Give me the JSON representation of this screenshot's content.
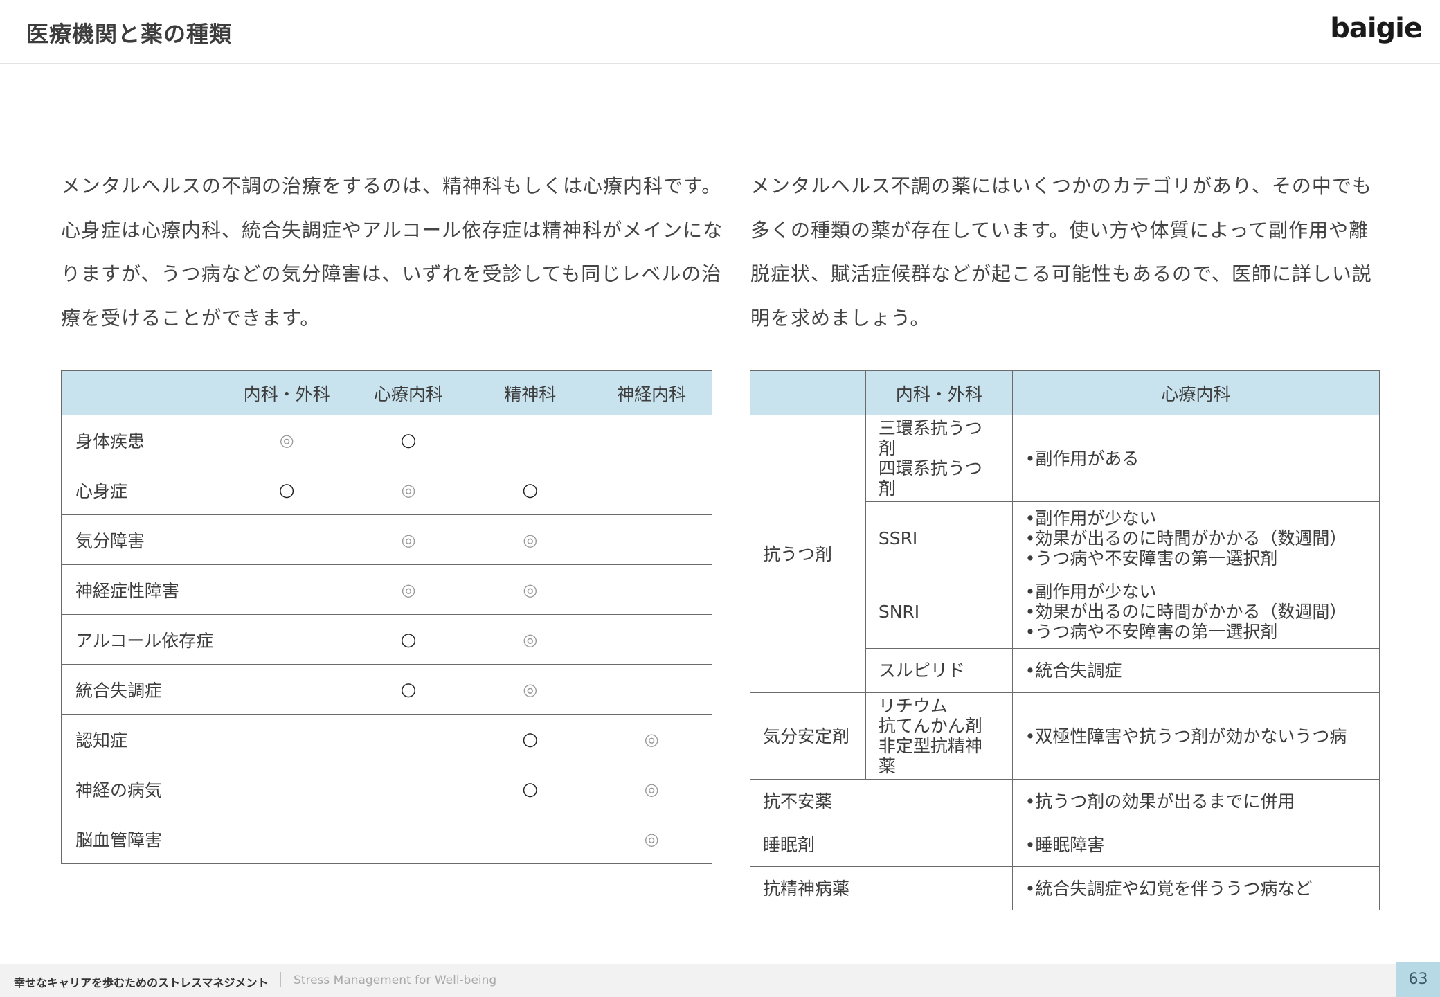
{
  "header": {
    "title": "医療機関と薬の種類",
    "logo": "baigie"
  },
  "intro": {
    "left": "メンタルヘルスの不調の治療をするのは、精神科もしくは心療内科です。心身症は心療内科、統合失調症やアルコール依存症は精神科がメインになりますが、うつ病などの気分障害は、いずれを受診しても同じレベルの治療を受けることができます。",
    "right": "メンタルヘルス不調の薬にはいくつかのカテゴリがあり、その中でも多くの種類の薬が存在しています。使い方や体質によって副作用や離脱症状、賦活症候群などが起こる可能性もあるので、医師に詳しい説明を求めましょう。"
  },
  "table_left": {
    "headers": [
      "",
      "内科・外科",
      "心療内科",
      "精神科",
      "神経内科"
    ],
    "rows": [
      {
        "label": "身体疾患",
        "cells": [
          "◎",
          "○",
          "",
          ""
        ]
      },
      {
        "label": "心身症",
        "cells": [
          "○",
          "◎",
          "○",
          ""
        ]
      },
      {
        "label": "気分障害",
        "cells": [
          "",
          "◎",
          "◎",
          ""
        ]
      },
      {
        "label": "神経症性障害",
        "cells": [
          "",
          "◎",
          "◎",
          ""
        ]
      },
      {
        "label": "アルコール依存症",
        "cells": [
          "",
          "○",
          "◎",
          ""
        ]
      },
      {
        "label": "統合失調症",
        "cells": [
          "",
          "○",
          "◎",
          ""
        ]
      },
      {
        "label": "認知症",
        "cells": [
          "",
          "",
          "○",
          "◎"
        ]
      },
      {
        "label": "神経の病気",
        "cells": [
          "",
          "",
          "○",
          "◎"
        ]
      },
      {
        "label": "脳血管障害",
        "cells": [
          "",
          "",
          "",
          "◎"
        ]
      }
    ]
  },
  "table_right": {
    "headers": [
      "",
      "内科・外科",
      "心療内科"
    ],
    "groups": [
      {
        "category": "抗うつ剤",
        "items": [
          {
            "names": [
              "三環系抗うつ剤",
              "四環系抗うつ剤"
            ],
            "notes": [
              "副作用がある"
            ]
          },
          {
            "names": [
              "SSRI"
            ],
            "notes": [
              "副作用が少ない",
              "効果が出るのに時間がかかる（数週間）",
              "うつ病や不安障害の第一選択剤"
            ]
          },
          {
            "names": [
              "SNRI"
            ],
            "notes": [
              "副作用が少ない",
              "効果が出るのに時間がかかる（数週間）",
              "うつ病や不安障害の第一選択剤"
            ]
          },
          {
            "names": [
              "スルピリド"
            ],
            "notes": [
              "統合失調症"
            ]
          }
        ]
      },
      {
        "category": "気分安定剤",
        "items": [
          {
            "names": [
              "リチウム",
              "抗てんかん剤",
              "非定型抗精神薬"
            ],
            "notes": [
              "双極性障害や抗うつ剤が効かないうつ病"
            ]
          }
        ]
      }
    ],
    "singles": [
      {
        "category": "抗不安薬",
        "note": "抗うつ剤の効果が出るまでに併用"
      },
      {
        "category": "睡眠剤",
        "note": "睡眠障害"
      },
      {
        "category": "抗精神病薬",
        "note": "統合失調症や幻覚を伴ううつ病など"
      }
    ]
  },
  "footer": {
    "title": "幸せなキャリアを歩むためのストレスマネジメント",
    "subtitle": "Stress Management for Well-being",
    "page": "63"
  }
}
